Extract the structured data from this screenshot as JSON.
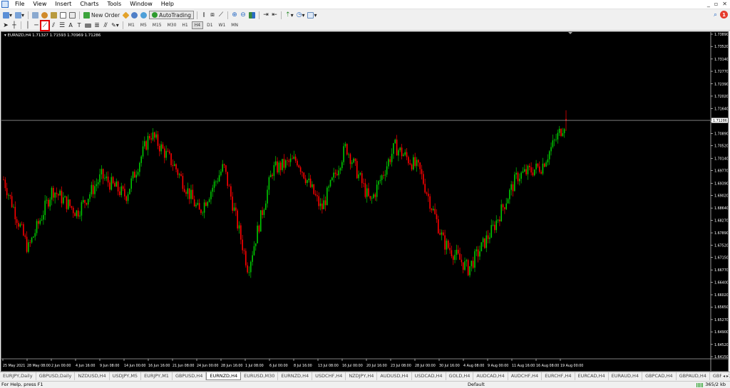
{
  "menu": [
    "File",
    "View",
    "Insert",
    "Charts",
    "Tools",
    "Window",
    "Help"
  ],
  "toolbar": {
    "new_order_label": "New Order",
    "autotrading_label": "AutoTrading"
  },
  "timeframes": [
    "M1",
    "M5",
    "M15",
    "M30",
    "H1",
    "H4",
    "D1",
    "W1",
    "MN"
  ],
  "active_timeframe": "H4",
  "chart": {
    "info": "EURNZD,H4  1.71327 1.71593 1.70969 1.71286",
    "current_price_label": "1.71286",
    "current_price": 1.71286,
    "price_ticks": [
      "1.73890",
      "1.73520",
      "1.73140",
      "1.72770",
      "1.72390",
      "1.72020",
      "1.71640",
      "1.71260",
      "1.70890",
      "1.70520",
      "1.70140",
      "1.69770",
      "1.69390",
      "1.69020",
      "1.68640",
      "1.68270",
      "1.67890",
      "1.67520",
      "1.67150",
      "1.66770",
      "1.66400",
      "1.66020",
      "1.65650",
      "1.65270",
      "1.64900",
      "1.64520",
      "1.64150"
    ],
    "time_ticks": [
      "25 May 2021",
      "28 May 08:00",
      "2 Jun 00:00",
      "4 Jun 16:00",
      "9 Jun 08:00",
      "14 Jun 00:00",
      "16 Jun 16:00",
      "21 Jun 08:00",
      "24 Jun 00:00",
      "28 Jun 16:00",
      "1 Jul 08:00",
      "6 Jul 00:00",
      "8 Jul 16:00",
      "13 Jul 08:00",
      "16 Jul 00:00",
      "20 Jul 16:00",
      "23 Jul 08:00",
      "28 Jul 00:00",
      "30 Jul 16:00",
      "4 Aug 08:00",
      "9 Aug 00:00",
      "11 Aug 16:00",
      "16 Aug 08:00",
      "19 Aug 00:00"
    ],
    "colors": {
      "background": "#000000",
      "bull": "#00c800",
      "bear": "#ff0000",
      "grid_text": "#ffffff"
    }
  },
  "chart_data": {
    "type": "candlestick",
    "symbol": "EURNZD",
    "timeframe": "H4",
    "ylim": [
      1.6415,
      1.7389
    ],
    "x": [
      "25 May 2021",
      "28 May 08:00",
      "2 Jun 00:00",
      "4 Jun 16:00",
      "9 Jun 08:00",
      "14 Jun 00:00",
      "16 Jun 16:00",
      "21 Jun 08:00",
      "24 Jun 00:00",
      "28 Jun 16:00",
      "1 Jul 08:00",
      "6 Jul 00:00",
      "8 Jul 16:00",
      "13 Jul 08:00",
      "16 Jul 00:00",
      "20 Jul 16:00",
      "23 Jul 08:00",
      "28 Jul 00:00",
      "30 Jul 16:00",
      "4 Aug 08:00",
      "9 Aug 00:00",
      "11 Aug 16:00",
      "16 Aug 08:00",
      "19 Aug 00:00"
    ],
    "close_path": [
      1.695,
      1.674,
      1.692,
      1.685,
      1.696,
      1.69,
      1.709,
      1.699,
      1.685,
      1.699,
      1.668,
      1.698,
      1.701,
      1.686,
      1.705,
      1.688,
      1.705,
      1.698,
      1.676,
      1.668,
      1.68,
      1.696,
      1.699,
      1.7129
    ],
    "last_ohlc": {
      "open": 1.71327,
      "high": 1.71593,
      "low": 1.70969,
      "close": 1.71286
    }
  },
  "tabs": [
    "EURJPY,Daily",
    "GBPUSD,Daily",
    "NZDUSD,H4",
    "USDJPY,M5",
    "EURJPY,M1",
    "GBPUSD,H4",
    "EURNZD,H4",
    "EURUSD,M30",
    "EURNZD,H4",
    "USDCHF,H4",
    "NZDJPY,H4",
    "AUDUSD,H4",
    "USDCAD,H4",
    "GOLD,H4",
    "AUDCAD,H4",
    "AUDCHF,H4",
    "EURCHF,H4",
    "EURCAD,H4",
    "EURAUD,H4",
    "GBPCAD,H4",
    "GBPAUD,H4",
    "GBPJPY,H4"
  ],
  "active_tab_index": 6,
  "status": {
    "help": "For Help, press F1",
    "profile": "Default",
    "traffic": "365/2 kb"
  }
}
